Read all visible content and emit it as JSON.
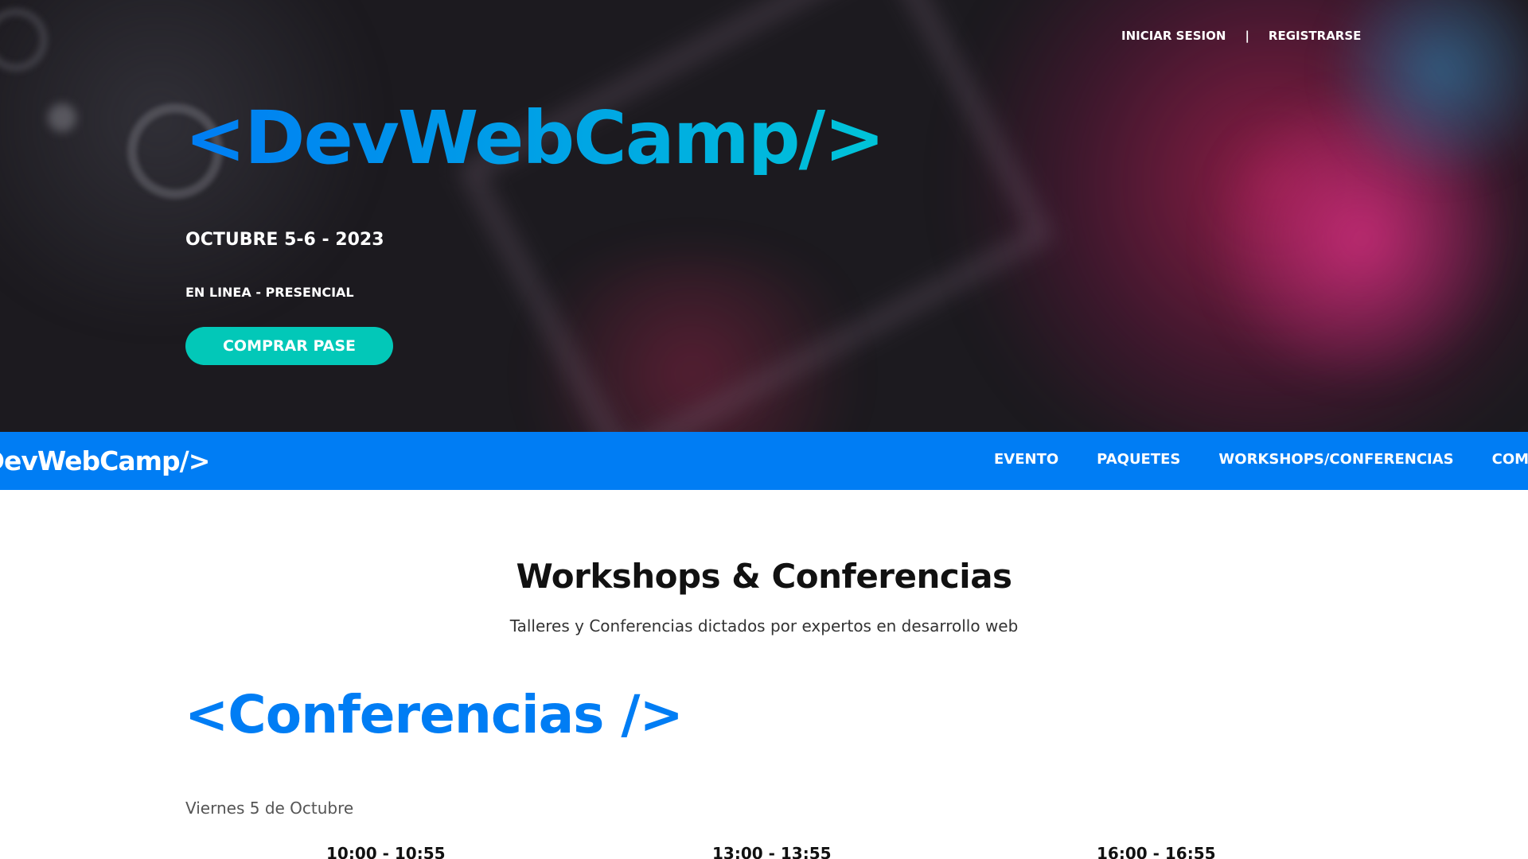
{
  "header": {
    "login_label": "INICIAR SESION",
    "separator": "|",
    "register_label": "REGISTRARSE"
  },
  "hero": {
    "logo_text": "<DevWebCamp/>",
    "date": "OCTUBRE 5-6 - 2023",
    "mode": "EN LINEA - PRESENCIAL",
    "cta_label": "COMPRAR PASE"
  },
  "nav": {
    "logo_text": "<DevWebCamp/>",
    "links": [
      "EVENTO",
      "PAQUETES",
      "WORKSHOPS/CONFERENCIAS",
      "COMPRAR PASE"
    ]
  },
  "section": {
    "title": "Workshops & Conferencias",
    "subtitle": "Talleres y Conferencias dictados por expertos en desarrollo web"
  },
  "conferencias": {
    "heading": "<Conferencias />",
    "day": "Viernes 5 de Octubre",
    "times": [
      "10:00 - 10:55",
      "13:00 - 13:55",
      "16:00 - 16:55"
    ]
  },
  "colors": {
    "brand_blue": "#007df4",
    "brand_teal": "#02c8b8"
  }
}
